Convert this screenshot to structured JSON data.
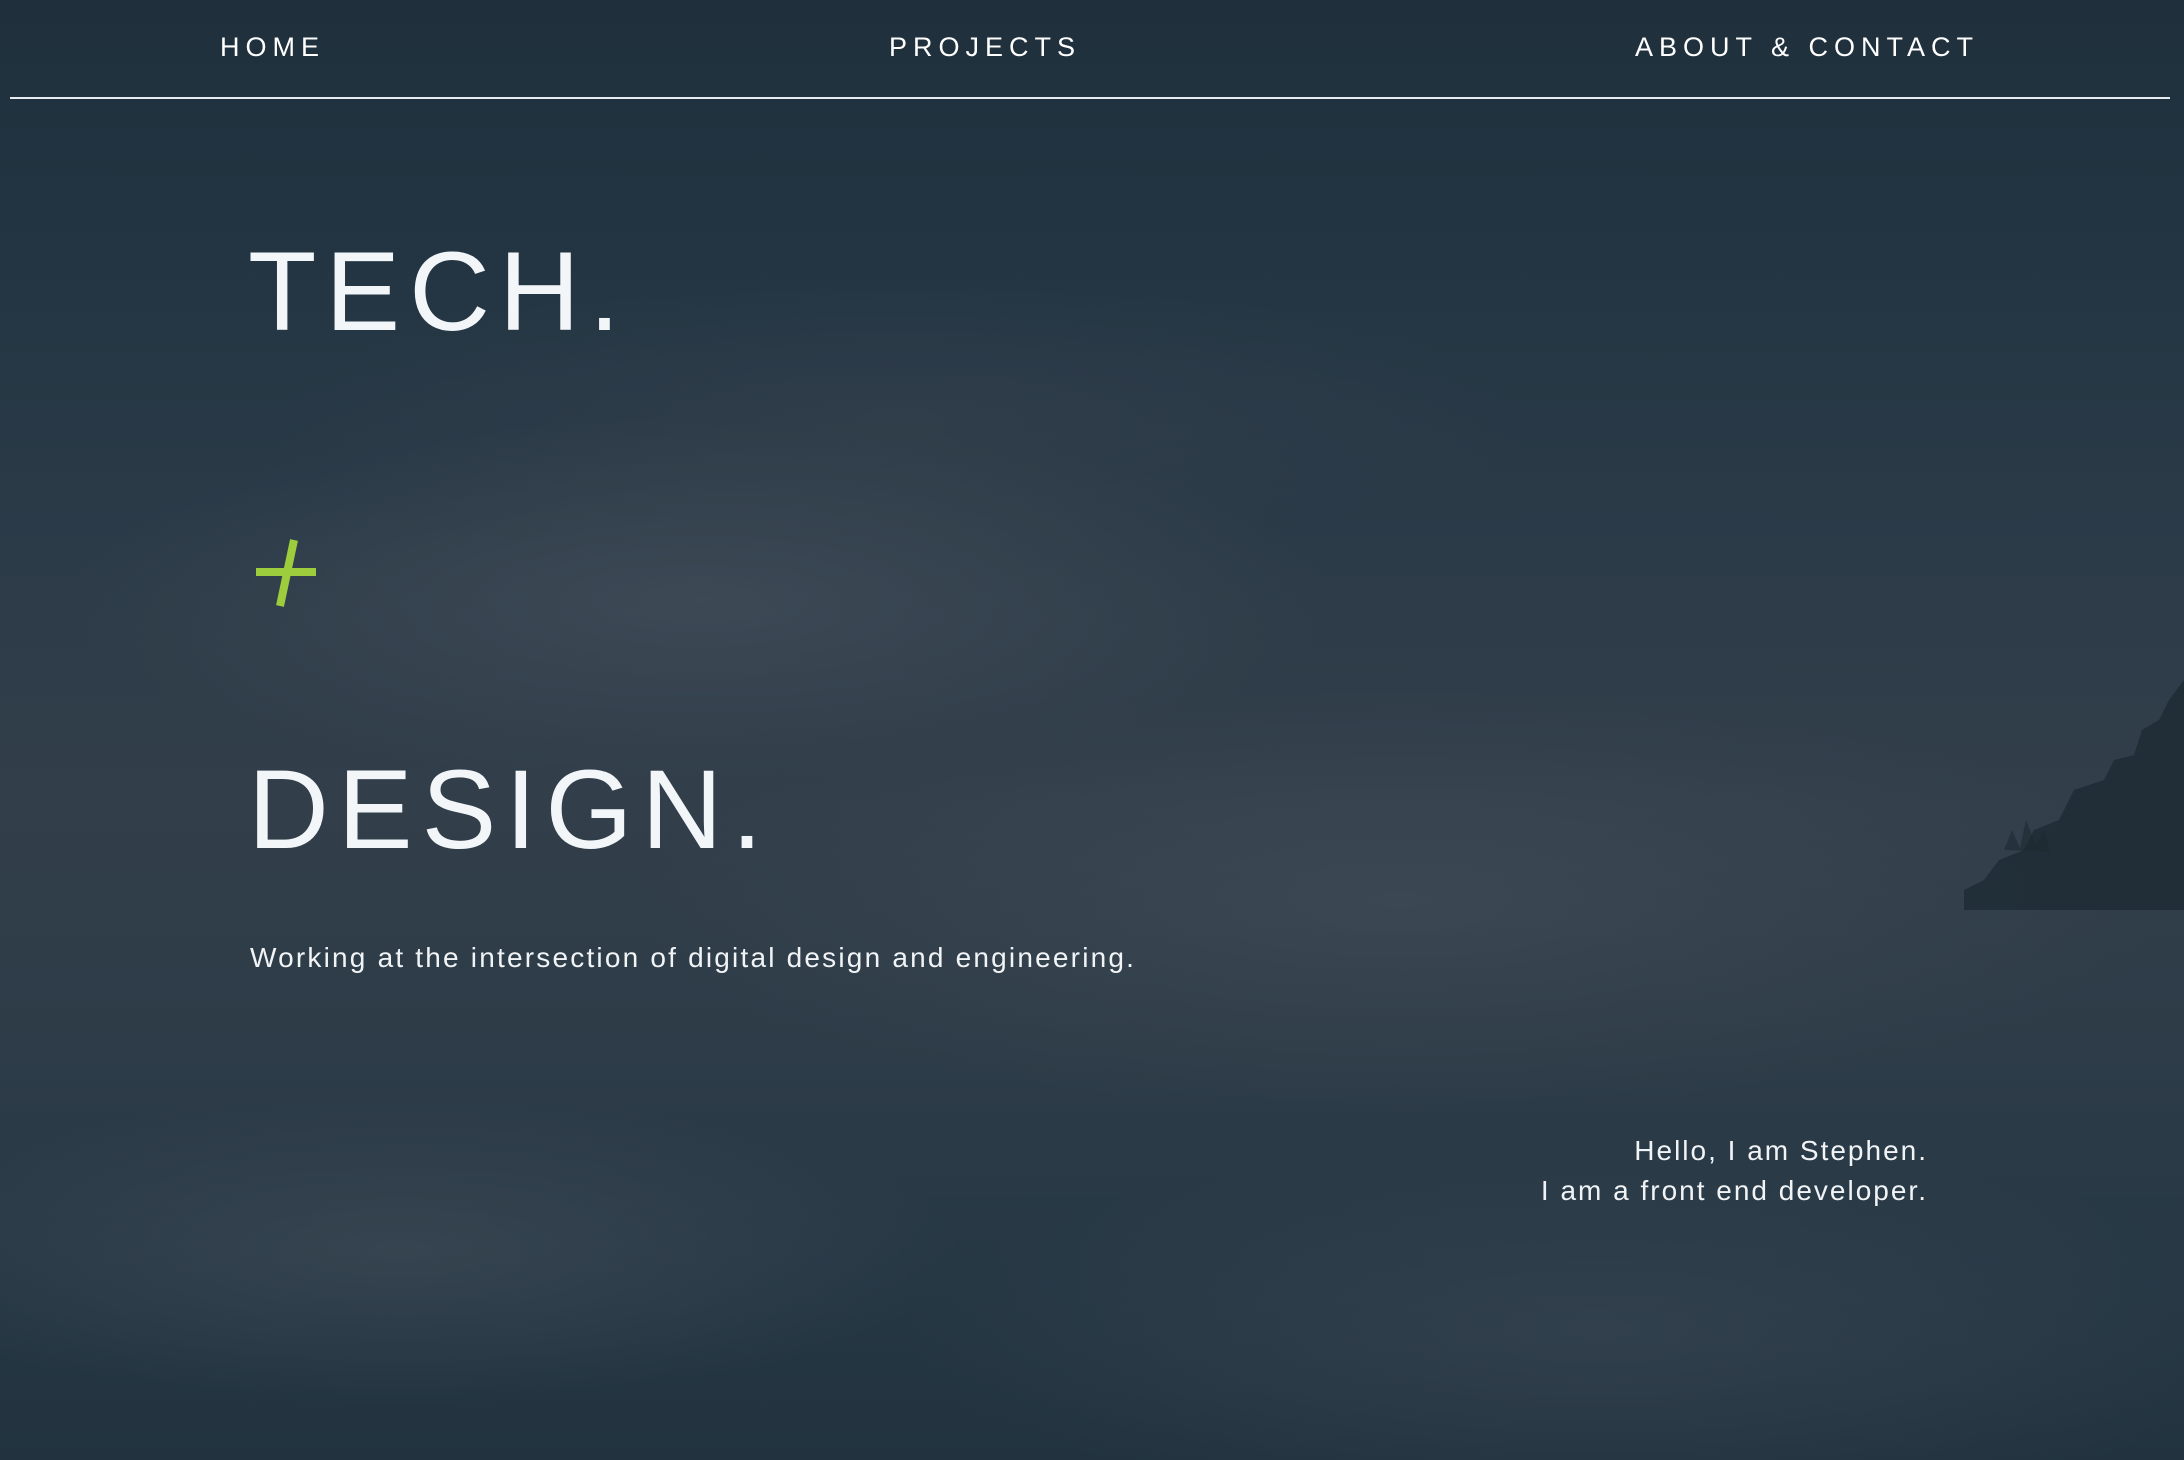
{
  "nav": {
    "items": [
      {
        "label": "HOME"
      },
      {
        "label": "PROJECTS"
      },
      {
        "label": "ABOUT & CONTACT"
      }
    ]
  },
  "hero": {
    "line1": "TECH.",
    "plus": "+",
    "line2": "DESIGN.",
    "tagline": "Working at the intersection of digital design and engineering."
  },
  "intro": {
    "line1": "Hello, I am Stephen.",
    "line2": "I am a front end developer."
  },
  "colors": {
    "accent": "#9dcd3c",
    "text": "#f1f4f6",
    "background": "#2b3a46"
  },
  "icons": {
    "plus": "plus-icon"
  }
}
